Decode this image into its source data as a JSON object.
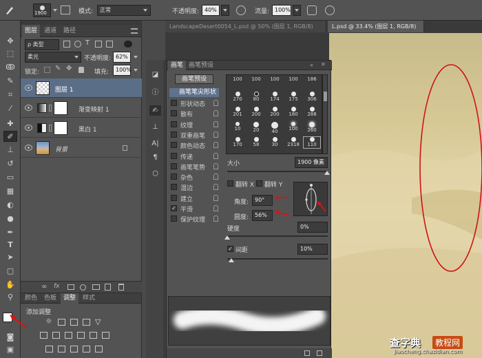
{
  "options_bar": {
    "brush_size": "1900",
    "mode_label": "模式:",
    "mode_value": "正常",
    "opacity_label": "不透明度:",
    "opacity_value": "40%",
    "flow_label": "流量:",
    "flow_value": "100%"
  },
  "document_tabs": [
    {
      "label": "LandscapeDesert0054_L.psd @ 50% (图层 1, RGB/8)"
    },
    {
      "label": "L.psd @ 33.4% (图层 1, RGB/8)"
    }
  ],
  "layers_panel": {
    "tabs": [
      "图层",
      "通道",
      "路径"
    ],
    "filter_label": "ρ 类型",
    "blend_mode": "柔光",
    "opacity_label": "不透明度:",
    "opacity_value": "62%",
    "lock_label": "锁定:",
    "fill_label": "填充:",
    "fill_value": "100%",
    "layers": [
      {
        "name": "图层 1",
        "selected": true
      },
      {
        "name": "渐变映射 1",
        "selected": false
      },
      {
        "name": "黑白 1",
        "selected": false
      },
      {
        "name": "背景",
        "selected": false
      }
    ]
  },
  "adjustments_panel": {
    "tabs": [
      "颜色",
      "色板",
      "调整",
      "样式"
    ],
    "title": "添加调整"
  },
  "brush_panel": {
    "tabs": [
      "画笔",
      "画笔预设"
    ],
    "preset_button": "画笔预设",
    "tip_shape_label": "画笔笔尖形状",
    "options": [
      {
        "label": "形状动态",
        "checked": false
      },
      {
        "label": "散布",
        "checked": false
      },
      {
        "label": "纹理",
        "checked": false
      },
      {
        "label": "双重画笔",
        "checked": false
      },
      {
        "label": "颜色动态",
        "checked": false
      },
      {
        "label": "传递",
        "checked": false
      },
      {
        "label": "画笔笔势",
        "checked": false
      },
      {
        "label": "杂色",
        "checked": false
      },
      {
        "label": "湿边",
        "checked": false
      },
      {
        "label": "建立",
        "checked": false
      },
      {
        "label": "平滑",
        "checked": true
      },
      {
        "label": "保护纹理",
        "checked": false
      }
    ],
    "tip_sizes": [
      "100",
      "100",
      "100",
      "100",
      "186",
      "270",
      "80",
      "174",
      "175",
      "306",
      "201",
      "200",
      "200",
      "180",
      "288",
      "10",
      "20",
      "40",
      "100",
      "260",
      "170",
      "58",
      "30",
      "2318",
      "110"
    ],
    "size_label": "大小",
    "size_value": "1900 像素",
    "flip_x": "翻转 X",
    "flip_y": "翻转 Y",
    "angle_label": "角度:",
    "angle_value": "90°",
    "roundness_label": "圆度:",
    "roundness_value": "56%",
    "hardness_label": "硬度",
    "hardness_value": "0%",
    "spacing_label": "间距",
    "spacing_value": "10%",
    "spacing_checked": true
  },
  "watermark": {
    "brand": "查字典",
    "brand_suffix": "教程网",
    "url": "jiaocheng.chazidian.com"
  }
}
